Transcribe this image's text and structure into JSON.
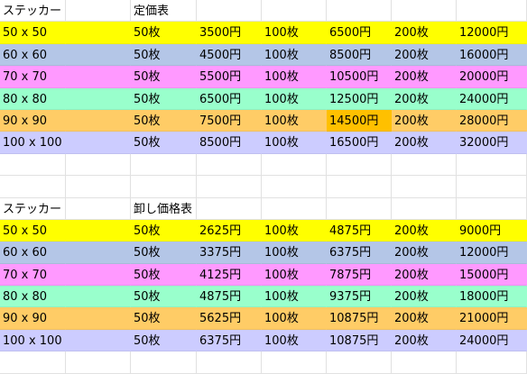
{
  "retail": {
    "header": {
      "label": "ステッカー",
      "title": "定価表"
    },
    "rows": [
      {
        "size": "50 x 50",
        "q1": "50枚",
        "p1": "3500円",
        "q2": "100枚",
        "p2": "6500円",
        "q3": "200枚",
        "p3": "12000円",
        "color": "#ffff00"
      },
      {
        "size": "60 x 60",
        "q1": "50枚",
        "p1": "4500円",
        "q2": "100枚",
        "p2": "8500円",
        "q3": "200枚",
        "p3": "16000円",
        "color": "#b4c6e7"
      },
      {
        "size": "70 x 70",
        "q1": "50枚",
        "p1": "5500円",
        "q2": "100枚",
        "p2": "10500円",
        "q3": "200枚",
        "p3": "20000円",
        "color": "#ff99ff"
      },
      {
        "size": "80 x 80",
        "q1": "50枚",
        "p1": "6500円",
        "q2": "100枚",
        "p2": "12500円",
        "q3": "200枚",
        "p3": "24000円",
        "color": "#99ffcc"
      },
      {
        "size": "90 x 90",
        "q1": "50枚",
        "p1": "7500円",
        "q2": "100枚",
        "p2": "14500円",
        "q3": "200枚",
        "p3": "28000円",
        "color": "#ffcc66",
        "highlight_cell": "p2",
        "highlight_color": "#ffc000"
      },
      {
        "size": "100 x 100",
        "q1": "50枚",
        "p1": "8500円",
        "q2": "100枚",
        "p2": "16500円",
        "q3": "200枚",
        "p3": "32000円",
        "color": "#ccccff"
      }
    ]
  },
  "wholesale": {
    "header": {
      "label": "ステッカー",
      "title": "卸し価格表"
    },
    "rows": [
      {
        "size": "50 x 50",
        "q1": "50枚",
        "p1": "2625円",
        "q2": "100枚",
        "p2": "4875円",
        "q3": "200枚",
        "p3": "9000円",
        "color": "#ffff00"
      },
      {
        "size": "60 x 60",
        "q1": "50枚",
        "p1": "3375円",
        "q2": "100枚",
        "p2": "6375円",
        "q3": "200枚",
        "p3": "12000円",
        "color": "#b4c6e7"
      },
      {
        "size": "70 x 70",
        "q1": "50枚",
        "p1": "4125円",
        "q2": "100枚",
        "p2": "7875円",
        "q3": "200枚",
        "p3": "15000円",
        "color": "#ff99ff"
      },
      {
        "size": "80 x 80",
        "q1": "50枚",
        "p1": "4875円",
        "q2": "100枚",
        "p2": "9375円",
        "q3": "200枚",
        "p3": "18000円",
        "color": "#99ffcc"
      },
      {
        "size": "90 x 90",
        "q1": "50枚",
        "p1": "5625円",
        "q2": "100枚",
        "p2": "10875円",
        "q3": "200枚",
        "p3": "21000円",
        "color": "#ffcc66"
      },
      {
        "size": "100 x 100",
        "q1": "50枚",
        "p1": "6375円",
        "q2": "100枚",
        "p2": "10875円",
        "q3": "200枚",
        "p3": "24000円",
        "color": "#ccccff"
      }
    ]
  }
}
